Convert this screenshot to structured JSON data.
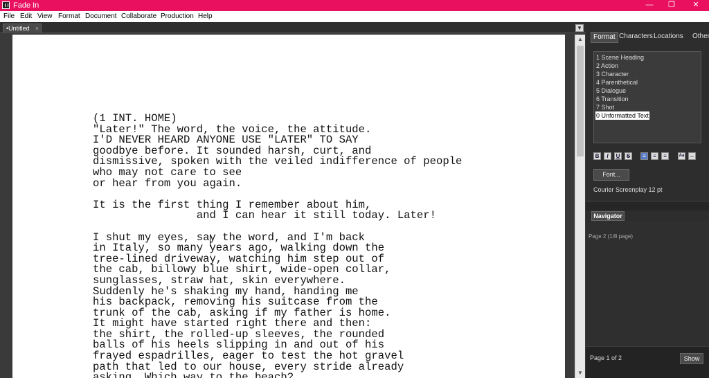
{
  "window": {
    "title": "Fade In",
    "minimize_glyph": "—",
    "restore_glyph": "❐",
    "close_glyph": "✕",
    "accent_color": "#e8105f"
  },
  "menubar": {
    "items": [
      "File",
      "Edit",
      "View",
      "Format",
      "Document",
      "Collaborate",
      "Production",
      "Help"
    ]
  },
  "document_tab": {
    "label": "•Untitled",
    "close_glyph": "×",
    "dropdown_glyph": "▼"
  },
  "script": {
    "lines": [
      "(1 INT. HOME)",
      "\"Later!\" The word, the voice, the attitude.",
      "I'D NEVER HEARD ANYONE USE \"LATER\" TO SAY",
      "goodbye before. It sounded harsh, curt, and",
      "dismissive, spoken with the veiled indifference of people",
      "who may not care to see",
      "or hear from you again.",
      "",
      "It is the first thing I remember about him,",
      "                and I can hear it still today. Later!",
      "",
      "I shut my eyes, say the word, and I'm back",
      "in Italy, so many years ago, walking down the",
      "tree-lined driveway, watching him step out of",
      "the cab, billowy blue shirt, wide-open collar,",
      "sunglasses, straw hat, skin everywhere.",
      "Suddenly he's shaking my hand, handing me",
      "his backpack, removing his suitcase from the",
      "trunk of the cab, asking if my father is home.",
      "It might have started right there and then:",
      "the shirt, the rolled-up sleeves, the rounded",
      "balls of his heels slipping in and out of his",
      "frayed espadrilles, eager to test the hot gravel",
      "path that led to our house, every stride already",
      "asking, Which way to the beach?"
    ]
  },
  "scrollbar": {
    "up_glyph": "▲",
    "down_glyph": "▼"
  },
  "side_panel": {
    "tabs": [
      "Format",
      "Characters",
      "Locations",
      "Other"
    ],
    "active_tab": "Format",
    "format_items": [
      "1 Scene Heading",
      "2 Action",
      "3 Character",
      "4 Parenthetical",
      "5 Dialogue",
      "6 Transition",
      "7 Shot",
      "0 Unformatted Text"
    ],
    "selected_format": "0 Unformatted Text",
    "toolbar": {
      "bold": "B",
      "italic": "I",
      "underline": "U",
      "strike": "S",
      "align_left": "≡",
      "align_center": "≡",
      "align_right": "≡",
      "aa": "Aa",
      "link": "⇔"
    },
    "font_button": "Font...",
    "font_description": "Courier Screenplay 12 pt"
  },
  "navigator": {
    "tab": "Navigator",
    "info": "Page 2 (1/8 page)",
    "page_indicator": "Page 1 of 2",
    "show_button": "Show"
  }
}
